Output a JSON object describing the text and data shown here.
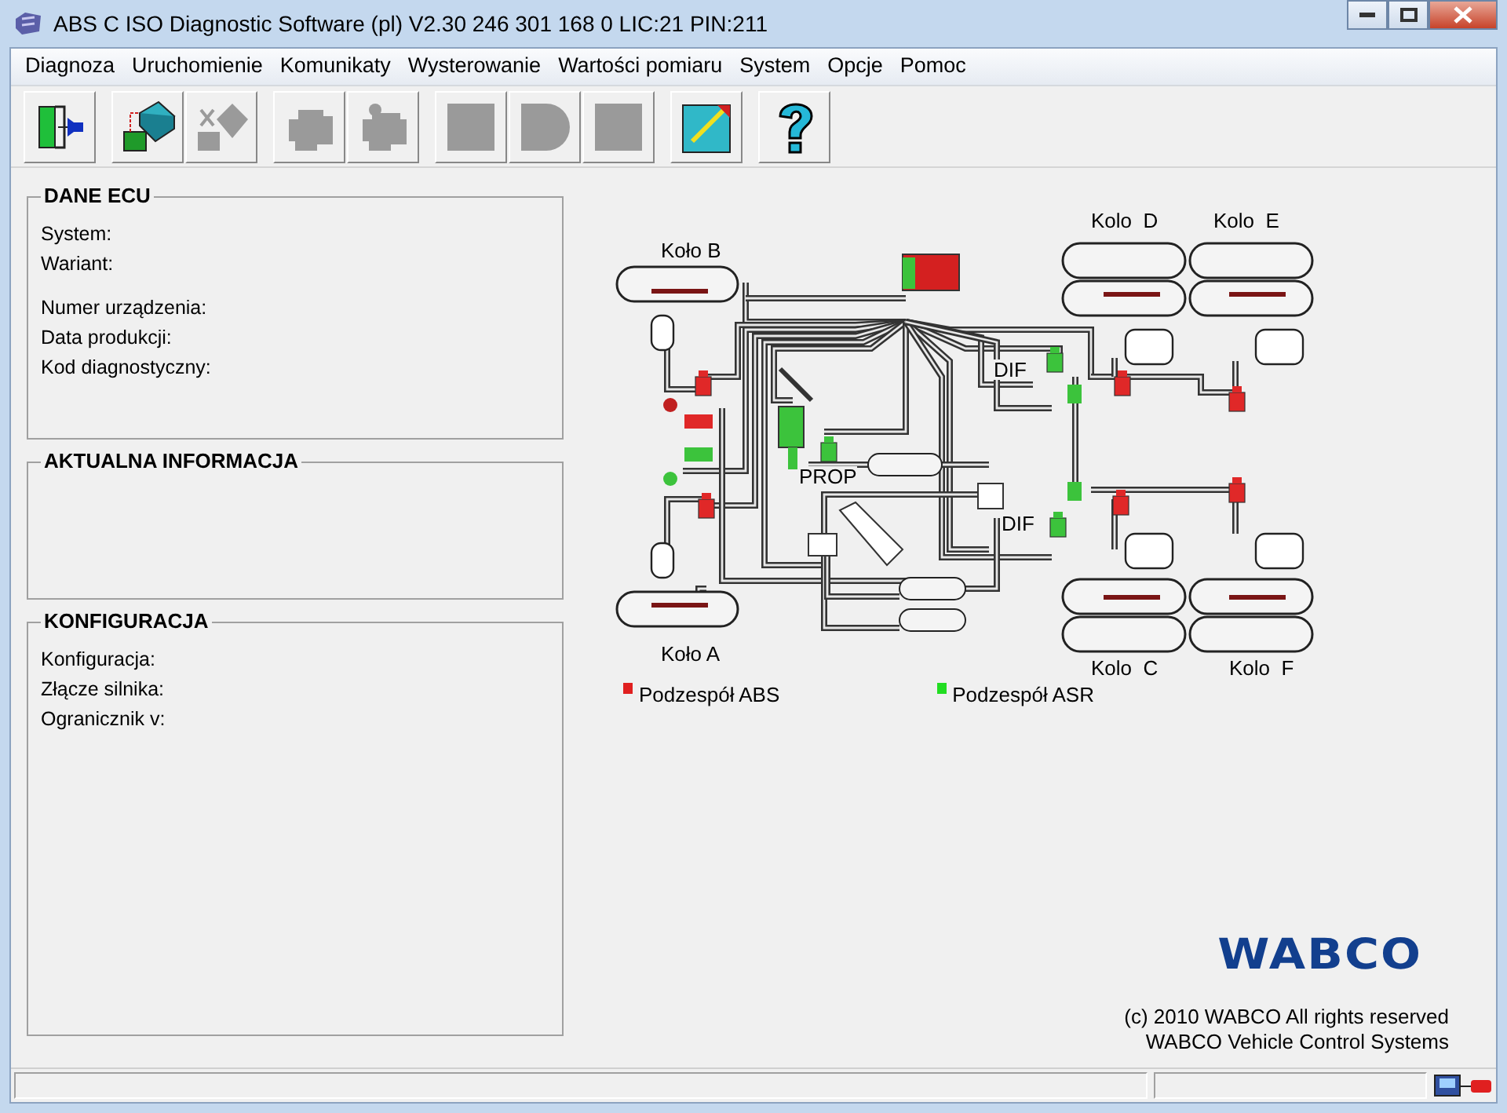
{
  "window": {
    "title": "ABS C ISO Diagnostic Software (pl) V2.30  246 301 168 0  LIC:21 PIN:211"
  },
  "menu": [
    "Diagnoza",
    "Uruchomienie",
    "Komunikaty",
    "Wysterowanie",
    "Wartości pomiaru",
    "System",
    "Opcje",
    "Pomoc"
  ],
  "toolbar_groups": [
    [
      {
        "kind": "exit",
        "disabled": false
      }
    ],
    [
      {
        "kind": "ecu-read",
        "disabled": false
      },
      {
        "kind": "ecu-clear",
        "disabled": true
      }
    ],
    [
      {
        "kind": "engine",
        "disabled": true
      },
      {
        "kind": "engine-fault",
        "disabled": true
      }
    ],
    [
      {
        "kind": "square",
        "disabled": true
      },
      {
        "kind": "round",
        "disabled": true
      },
      {
        "kind": "square",
        "disabled": true
      }
    ],
    [
      {
        "kind": "ecu-edit",
        "disabled": false
      }
    ],
    [
      {
        "kind": "help",
        "disabled": false
      }
    ]
  ],
  "panels": [
    {
      "title": "DANE ECU",
      "groups": [
        [
          "System:",
          "Wariant:"
        ],
        [
          "Numer urządzenia:",
          "Data produkcji:",
          "Kod diagnostyczny:"
        ]
      ]
    },
    {
      "title": "AKTUALNA INFORMACJA"
    },
    {
      "title": "KONFIGURACJA",
      "groups": [
        [
          "Konfiguracja:",
          "Złącze silnika:",
          "Ogranicznik v:"
        ]
      ]
    }
  ],
  "diagram": {
    "wheel_labels": [
      "Koło B",
      "Koło A",
      "Kolo  D",
      "Kolo  E",
      "Kolo  C",
      "Kolo  F"
    ],
    "valve_labels": [
      "DIF",
      "DIF",
      "PROP"
    ]
  },
  "legend": [
    {
      "label": "Podzespół ABS",
      "color": "#e02020"
    },
    {
      "label": "Podzespół ASR",
      "color": "#22dd22"
    }
  ],
  "logo": "WABCO",
  "copyright": [
    "(c) 2010 WABCO All rights reserved",
    "WABCO Vehicle Control Systems"
  ]
}
